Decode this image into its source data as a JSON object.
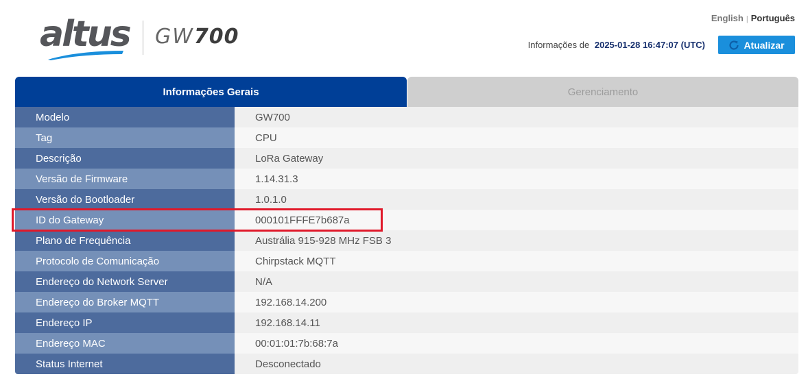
{
  "header": {
    "brand": "altus",
    "model_prefix": "GW",
    "model_number": "700",
    "languages": {
      "english": "English",
      "separator": "|",
      "portuguese": "Português"
    },
    "info_label": "Informações de",
    "timestamp": "2025-01-28 16:47:07 (UTC)",
    "refresh_label": "Atualizar"
  },
  "tabs": [
    {
      "label": "Informações Gerais",
      "active": true
    },
    {
      "label": "Gerenciamento",
      "active": false
    }
  ],
  "rows": [
    {
      "key": "Modelo",
      "value": "GW700"
    },
    {
      "key": "Tag",
      "value": "CPU"
    },
    {
      "key": "Descrição",
      "value": "LoRa Gateway"
    },
    {
      "key": "Versão de Firmware",
      "value": "1.14.31.3"
    },
    {
      "key": "Versão do Bootloader",
      "value": "1.0.1.0"
    },
    {
      "key": "ID do Gateway",
      "value": "000101FFFE7b687a"
    },
    {
      "key": "Plano de Frequência",
      "value": "Austrália 915-928 MHz FSB 3"
    },
    {
      "key": "Protocolo de Comunicação",
      "value": "Chirpstack MQTT"
    },
    {
      "key": "Endereço do Network Server",
      "value": "N/A"
    },
    {
      "key": "Endereço do Broker MQTT",
      "value": "192.168.14.200"
    },
    {
      "key": "Endereço IP",
      "value": "192.168.14.11"
    },
    {
      "key": "Endereço MAC",
      "value": "00:01:01:7b:68:7a"
    },
    {
      "key": "Status Internet",
      "value": "Desconectado"
    }
  ],
  "colors": {
    "tab_active": "#003f97",
    "button": "#1a8fdc",
    "highlight": "#e0192a",
    "swoosh": "#1a8fdc"
  },
  "icons": {
    "refresh": "refresh-icon"
  }
}
